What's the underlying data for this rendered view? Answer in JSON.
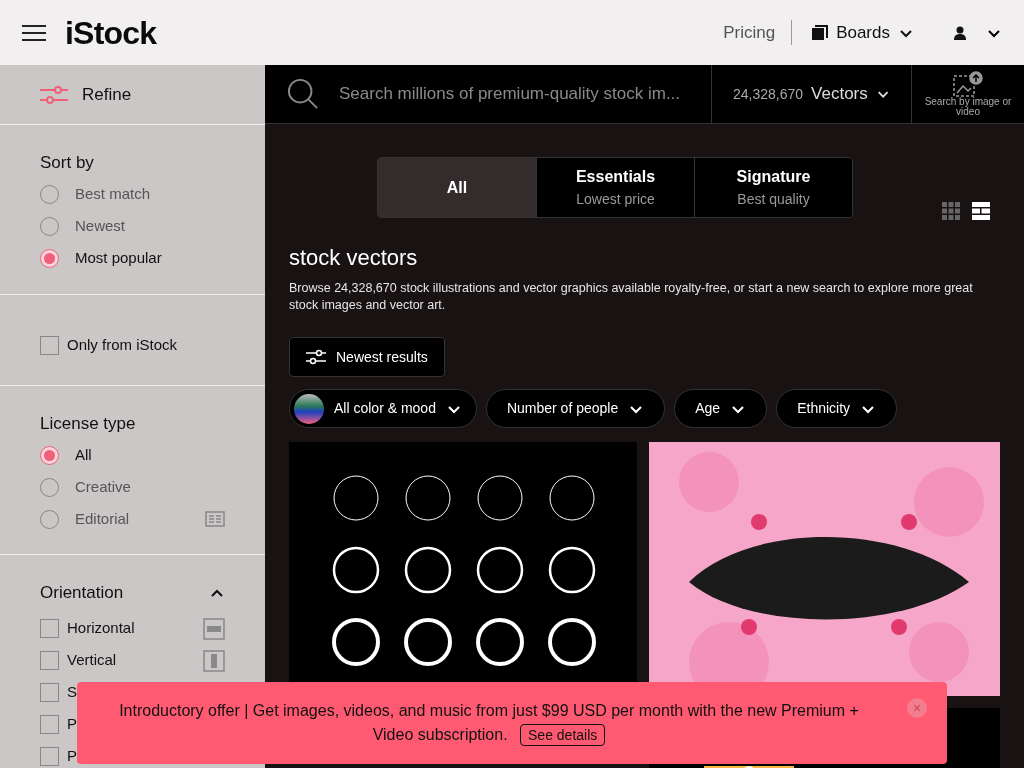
{
  "header": {
    "logo": "iStock",
    "pricing": "Pricing",
    "boards": "Boards"
  },
  "refine": {
    "label": "Refine"
  },
  "search": {
    "placeholder": "Search millions of premium-quality stock im...",
    "count": "24,328,670",
    "type": "Vectors",
    "image_search": "Search by image or video"
  },
  "sidebar": {
    "sections": [
      {
        "kind": "radio",
        "title": "Sort by",
        "items": [
          {
            "label": "Best match",
            "selected": false
          },
          {
            "label": "Newest",
            "selected": false
          },
          {
            "label": "Most popular",
            "selected": true
          }
        ]
      },
      {
        "kind": "checkbox",
        "items": [
          {
            "label": "Only from iStock",
            "checked": false
          }
        ]
      },
      {
        "kind": "radio",
        "title": "License type",
        "items": [
          {
            "label": "All",
            "selected": true
          },
          {
            "label": "Creative",
            "selected": false
          },
          {
            "label": "Editorial",
            "selected": false
          }
        ]
      },
      {
        "kind": "checkbox",
        "title": "Orientation",
        "expanded": true,
        "items": [
          {
            "label": "Horizontal",
            "checked": false
          },
          {
            "label": "Vertical",
            "checked": false
          },
          {
            "label": "S",
            "checked": false
          },
          {
            "label": "P",
            "checked": false
          },
          {
            "label": "P",
            "checked": false
          }
        ]
      }
    ]
  },
  "tabs": [
    {
      "label": "All",
      "selected": true
    },
    {
      "label": "Essentials",
      "sub": "Lowest price",
      "selected": false
    },
    {
      "label": "Signature",
      "sub": "Best quality",
      "selected": false
    }
  ],
  "view": [
    {
      "kind": "grid",
      "selected": false
    },
    {
      "kind": "mosaic",
      "selected": true
    }
  ],
  "title": "stock vectors",
  "description": "Browse 24,328,670 stock illustrations and vector graphics available royalty-free, or start a new search to explore more great stock images and vector art.",
  "newest_button": "Newest results",
  "filters": [
    {
      "label": "All color & mood",
      "kind": "color"
    },
    {
      "label": "Number of people"
    },
    {
      "label": "Age"
    },
    {
      "label": "Ethnicity"
    }
  ],
  "banner": {
    "text": "Introductory offer | Get images, videos, and music from just $99 USD per month with the new Premium + Video subscription.",
    "button": "See details",
    "close": "×"
  }
}
